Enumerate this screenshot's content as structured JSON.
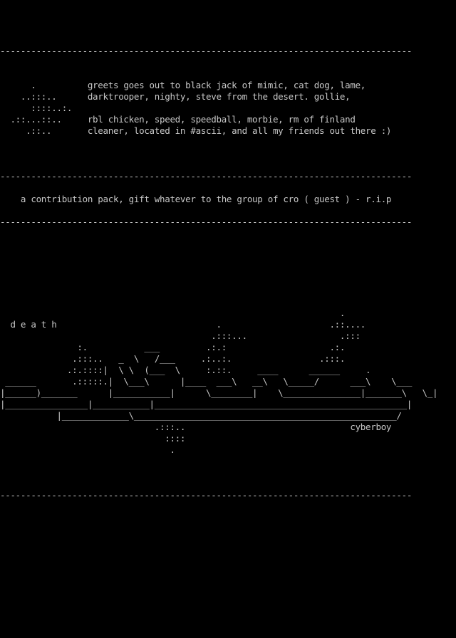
{
  "colors": {
    "background": "#000000",
    "text": "#c8c8c8"
  },
  "lines": [
    "",
    "",
    "",
    "",
    "--------------------------------------------------------------------------------",
    "",
    "",
    "      .          greets goes out to black jack of mimic, cat dog, lame,",
    "    ..:::..      darktrooper, nighty, steve from the desert. gollie,",
    "      ::::..:.",
    "  .::...::..     rbl chicken, speed, speedball, morbie, rm of finland",
    "     .::..       cleaner, located in #ascii, and all my friends out there :)",
    "",
    "",
    "",
    "--------------------------------------------------------------------------------",
    "",
    "    a contribution pack, gift whatever to the group of cro ( guest ) - r.i.p",
    "",
    "--------------------------------------------------------------------------------",
    "",
    "",
    "",
    "",
    "",
    "",
    "",
    "                                                                  .",
    "  d e a t h                               .                     .::....",
    "                                         .:::...                  .:::",
    "               :.           ___         .:.:                    .:.",
    "              .:::..   _  \\   /___     .:..:.                 .:::.",
    "             .:.::::|  \\ \\  (___  \\     :.::.     ____      ______     .",
    " ______       .:::::.|  \\___\\      |____  ___\\   __\\   \\_____/      ___\\    \\___",
    "|______)_______      |___________|      \\________|    \\_______________|_______\\   \\_|",
    "|________________|___________|_________________________________________________|",
    "           |_____________\\___________________________________________________/",
    "                              .:::..                                cyberboy",
    "                                ::::",
    "                                 .",
    "",
    "",
    "",
    "--------------------------------------------------------------------------------"
  ]
}
